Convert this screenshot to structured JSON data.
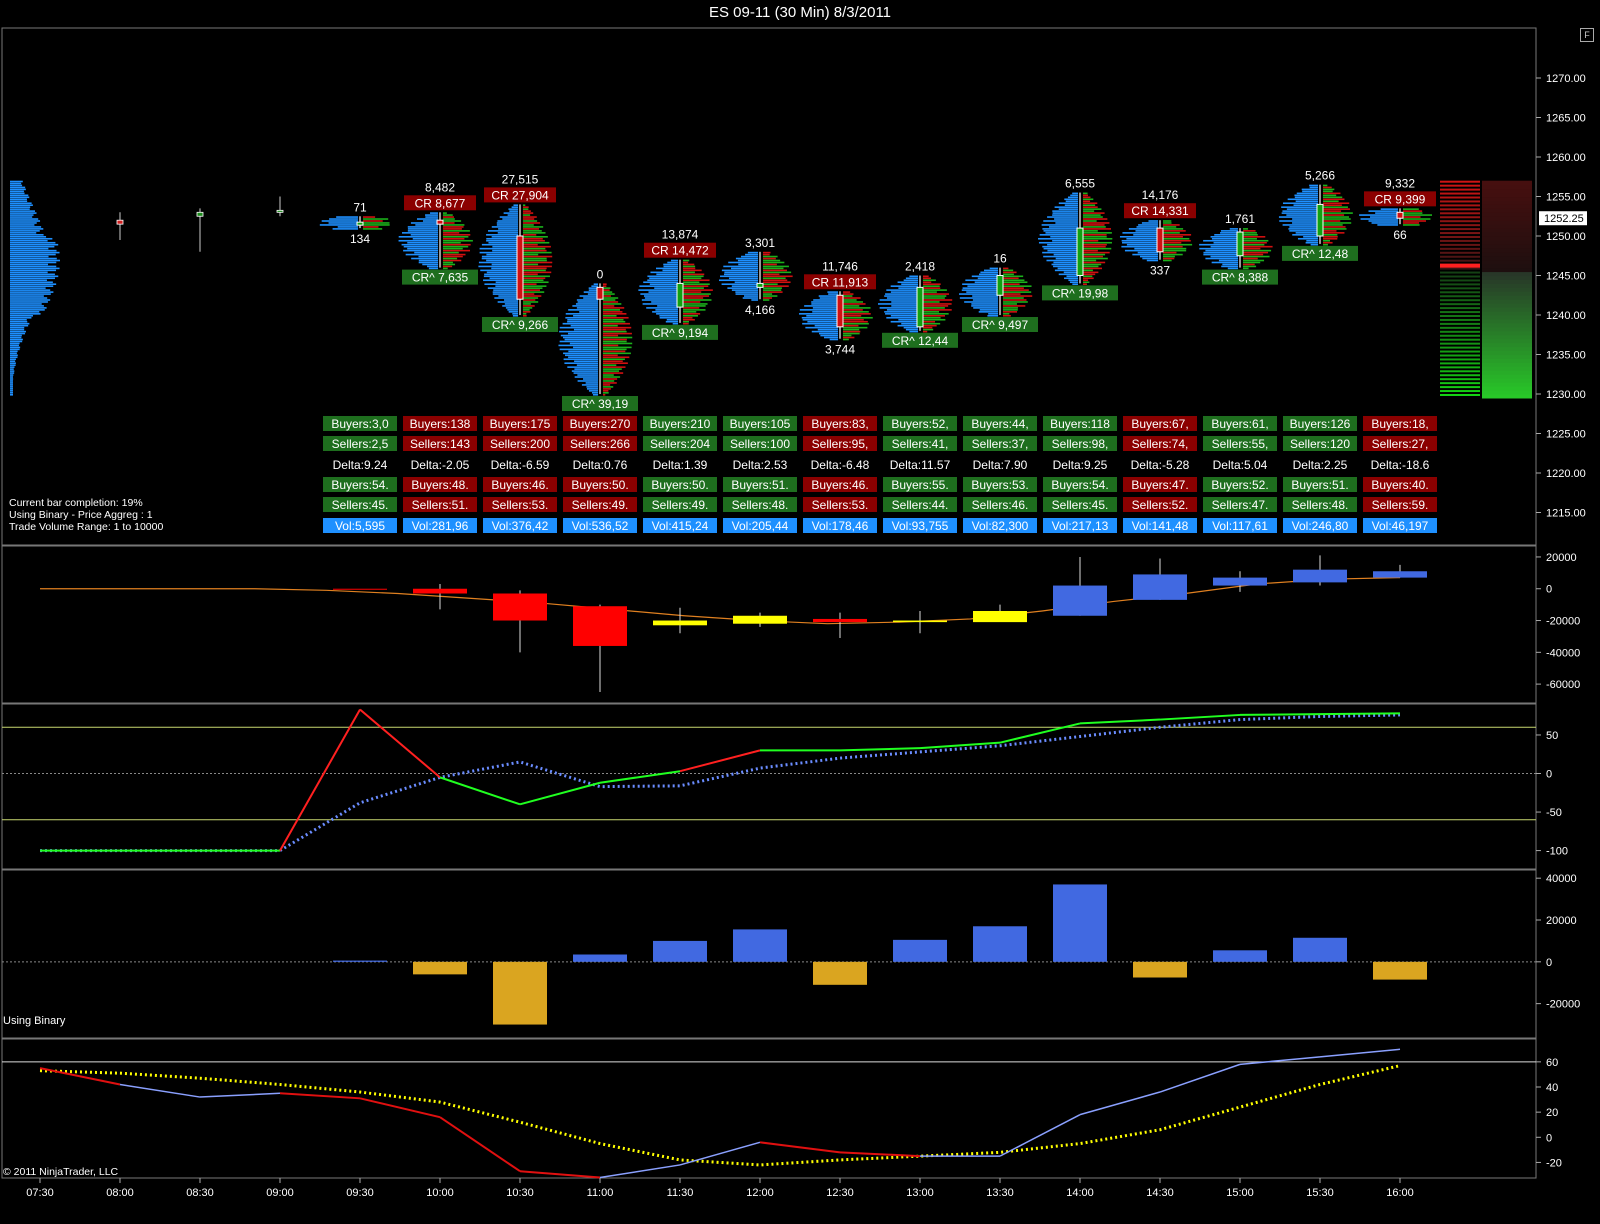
{
  "window": {
    "title": "ES 09-11 (30 Min)  8/3/2011",
    "flag_label": "F"
  },
  "time_labels": [
    "07:30",
    "08:00",
    "08:30",
    "09:00",
    "09:30",
    "10:00",
    "10:30",
    "11:00",
    "11:30",
    "12:00",
    "12:30",
    "13:00",
    "13:30",
    "14:00",
    "14:30",
    "15:00",
    "15:30",
    "16:00"
  ],
  "price_panel": {
    "info_lines": [
      "Current bar completion: 19%",
      "Using Binary - Price Aggreg : 1",
      "Trade Volume Range: 1 to 10000"
    ],
    "current_price": "1252.25",
    "y_ticks": [
      "1270.00",
      "1265.00",
      "1260.00",
      "1255.00",
      "1250.00",
      "1245.00",
      "1240.00",
      "1235.00",
      "1230.00",
      "1225.00",
      "1220.00",
      "1215.00"
    ]
  },
  "bars": [
    {
      "time": "09:30",
      "o": 1251.75,
      "h": 1252.5,
      "l": 1251,
      "c": 1251.5,
      "top": "71",
      "top_box": "",
      "bottom": "134",
      "bottom_box": "",
      "dir": "up",
      "buyers": "Buyers:3,0",
      "sellers": "Sellers:2,5",
      "delta": "Delta:9.24",
      "buyers_pct": "Buyers:54.",
      "sellers_pct": "Sellers:45.",
      "vol": "Vol:5,595"
    },
    {
      "time": "10:00",
      "o": 1252,
      "h": 1253,
      "l": 1246,
      "c": 1251.5,
      "top": "8,482",
      "top_box": "CR 8,677",
      "bottom": "",
      "bottom_box": "CR^ 7,635",
      "dir": "down",
      "buyers": "Buyers:138",
      "sellers": "Sellers:143",
      "delta": "Delta:-2.05",
      "buyers_pct": "Buyers:48.",
      "sellers_pct": "Sellers:51.",
      "vol": "Vol:281,96"
    },
    {
      "time": "10:30",
      "o": 1250,
      "h": 1254,
      "l": 1240,
      "c": 1242,
      "top": "27,515",
      "top_box": "CR 27,904",
      "bottom": "",
      "bottom_box": "CR^ 9,266",
      "dir": "down",
      "buyers": "Buyers:175",
      "sellers": "Sellers:200",
      "delta": "Delta:-6.59",
      "buyers_pct": "Buyers:46.",
      "sellers_pct": "Sellers:53.",
      "vol": "Vol:376,42"
    },
    {
      "time": "11:00",
      "o": 1243.5,
      "h": 1244,
      "l": 1230,
      "c": 1242,
      "top": "0",
      "top_box": "",
      "bottom": "",
      "bottom_box": "CR^ 39,19",
      "dir": "down",
      "buyers": "Buyers:270",
      "sellers": "Sellers:266",
      "delta": "Delta:0.76",
      "buyers_pct": "Buyers:50.",
      "sellers_pct": "Sellers:49.",
      "vol": "Vol:536,52"
    },
    {
      "time": "11:30",
      "o": 1241,
      "h": 1247,
      "l": 1239,
      "c": 1244,
      "top": "13,874",
      "top_box": "CR 14,472",
      "bottom": "",
      "bottom_box": "CR^ 9,194",
      "dir": "up",
      "buyers": "Buyers:210",
      "sellers": "Sellers:204",
      "delta": "Delta:1.39",
      "buyers_pct": "Buyers:50.",
      "sellers_pct": "Sellers:49.",
      "vol": "Vol:415,24"
    },
    {
      "time": "12:00",
      "o": 1243.5,
      "h": 1248,
      "l": 1242,
      "c": 1244,
      "top": "3,301",
      "top_box": "",
      "bottom": "4,166",
      "bottom_box": "",
      "dir": "up",
      "buyers": "Buyers:105",
      "sellers": "Sellers:100",
      "delta": "Delta:2.53",
      "buyers_pct": "Buyers:51.",
      "sellers_pct": "Sellers:48.",
      "vol": "Vol:205,44"
    },
    {
      "time": "12:30",
      "o": 1242.5,
      "h": 1243,
      "l": 1237,
      "c": 1238.5,
      "top": "11,746",
      "top_box": "CR 11,913",
      "bottom": "3,744",
      "bottom_box": "",
      "dir": "down",
      "buyers": "Buyers:83,",
      "sellers": "Sellers:95,",
      "delta": "Delta:-6.48",
      "buyers_pct": "Buyers:46.",
      "sellers_pct": "Sellers:53.",
      "vol": "Vol:178,46"
    },
    {
      "time": "13:00",
      "o": 1238.5,
      "h": 1245,
      "l": 1238,
      "c": 1243.5,
      "top": "2,418",
      "top_box": "",
      "bottom": "",
      "bottom_box": "CR^ 12,44",
      "dir": "up",
      "buyers": "Buyers:52,",
      "sellers": "Sellers:41,",
      "delta": "Delta:11.57",
      "buyers_pct": "Buyers:55.",
      "sellers_pct": "Sellers:44.",
      "vol": "Vol:93,755"
    },
    {
      "time": "13:30",
      "o": 1242.5,
      "h": 1246,
      "l": 1240,
      "c": 1245,
      "top": "16",
      "top_box": "",
      "bottom": "",
      "bottom_box": "CR^ 9,497",
      "dir": "up",
      "buyers": "Buyers:44,",
      "sellers": "Sellers:37,",
      "delta": "Delta:7.90",
      "buyers_pct": "Buyers:53.",
      "sellers_pct": "Sellers:46.",
      "vol": "Vol:82,300"
    },
    {
      "time": "14:00",
      "o": 1245,
      "h": 1255.5,
      "l": 1244,
      "c": 1251,
      "top": "6,555",
      "top_box": "",
      "bottom": "",
      "bottom_box": "CR^ 19,98",
      "dir": "up",
      "buyers": "Buyers:118",
      "sellers": "Sellers:98,",
      "delta": "Delta:9.25",
      "buyers_pct": "Buyers:54.",
      "sellers_pct": "Sellers:45.",
      "vol": "Vol:217,13"
    },
    {
      "time": "14:30",
      "o": 1251,
      "h": 1252,
      "l": 1247,
      "c": 1248,
      "top": "14,176",
      "top_box": "CR 14,331",
      "bottom": "337",
      "bottom_box": "",
      "dir": "down",
      "buyers": "Buyers:67,",
      "sellers": "Sellers:74,",
      "delta": "Delta:-5.28",
      "buyers_pct": "Buyers:47.",
      "sellers_pct": "Sellers:52.",
      "vol": "Vol:141,48"
    },
    {
      "time": "15:00",
      "o": 1247.5,
      "h": 1251,
      "l": 1246,
      "c": 1250.5,
      "top": "1,761",
      "top_box": "",
      "bottom": "",
      "bottom_box": "CR^ 8,388",
      "dir": "up",
      "buyers": "Buyers:61,",
      "sellers": "Sellers:55,",
      "delta": "Delta:5.04",
      "buyers_pct": "Buyers:52.",
      "sellers_pct": "Sellers:47.",
      "vol": "Vol:117,61"
    },
    {
      "time": "15:30",
      "o": 1250,
      "h": 1256.5,
      "l": 1249,
      "c": 1254,
      "top": "5,266",
      "top_box": "",
      "bottom": "",
      "bottom_box": "CR^ 12,48",
      "dir": "up",
      "buyers": "Buyers:126",
      "sellers": "Sellers:120",
      "delta": "Delta:2.25",
      "buyers_pct": "Buyers:51.",
      "sellers_pct": "Sellers:48.",
      "vol": "Vol:246,80"
    },
    {
      "time": "16:00",
      "o": 1253,
      "h": 1253.5,
      "l": 1251.5,
      "c": 1252.25,
      "top": "9,332",
      "top_box": "CR 9,399",
      "bottom": "66",
      "bottom_box": "",
      "dir": "down",
      "buyers": "Buyers:18,",
      "sellers": "Sellers:27,",
      "delta": "Delta:-18.6",
      "buyers_pct": "Buyers:40.",
      "sellers_pct": "Sellers:59.",
      "vol": "Vol:46,197"
    }
  ],
  "early_bars": [
    {
      "time": "08:00",
      "o": 1252,
      "h": 1253,
      "l": 1249.5,
      "c": 1251.5
    },
    {
      "time": "08:30",
      "o": 1252.5,
      "h": 1253.5,
      "l": 1248,
      "c": 1253
    },
    {
      "time": "09:00",
      "o": 1253,
      "h": 1255,
      "l": 1252.5,
      "c": 1253.25
    }
  ],
  "chart_data": [
    {
      "type": "candlestick",
      "panel": "delta candles",
      "y_ticks": [
        "20000",
        "0",
        "-20000",
        "-40000",
        "-60000"
      ],
      "ylim": [
        -70000,
        25000
      ],
      "x": [
        "09:30",
        "10:00",
        "10:30",
        "11:00",
        "11:30",
        "12:00",
        "12:30",
        "13:00",
        "13:30",
        "14:00",
        "14:30",
        "15:00",
        "15:30",
        "16:00"
      ],
      "open": [
        0,
        0,
        -3000,
        -11000,
        -20000,
        -17000,
        -19000,
        -21000,
        -14000,
        2000,
        -7000,
        2000,
        4000,
        7000
      ],
      "close": [
        0,
        -3000,
        -20000,
        -36000,
        -23000,
        -22000,
        -21000,
        -20000,
        -21000,
        -17000,
        9000,
        7000,
        12000,
        11000
      ],
      "high": [
        0,
        3000,
        -1000,
        -10000,
        -12000,
        -15000,
        -15000,
        -14000,
        -10000,
        20000,
        19000,
        11000,
        21000,
        15000
      ],
      "low": [
        0,
        -13000,
        -40000,
        -65000,
        -28000,
        -24000,
        -31000,
        -28000,
        -20000,
        -17000,
        -7000,
        -2000,
        2000,
        7000
      ],
      "colors": [
        "#ff0000",
        "#ff0000",
        "#ff0000",
        "#ff0000",
        "#ffff00",
        "#ffff00",
        "#ff0000",
        "#ffff00",
        "#ffff00",
        "#4169e1",
        "#4169e1",
        "#4169e1",
        "#4169e1",
        "#4169e1"
      ],
      "ma": [
        0,
        0,
        0,
        0,
        -1000,
        -3000,
        -6000,
        -9000,
        -13000,
        -17000,
        -20000,
        -22000,
        -21000,
        -19000,
        -14000,
        -8000,
        -3000,
        3000,
        6000,
        7000
      ]
    },
    {
      "type": "line",
      "panel": "oscillator",
      "y_ticks": [
        "50",
        "0",
        "-50",
        "-100"
      ],
      "ylim": [
        -120,
        85
      ],
      "levels": [
        60,
        0,
        -60
      ],
      "x": [
        "07:30",
        "08:00",
        "08:30",
        "09:00",
        "09:30",
        "10:00",
        "10:30",
        "11:00",
        "11:30",
        "12:00",
        "12:30",
        "13:00",
        "13:30",
        "14:00",
        "14:30",
        "15:00",
        "15:30",
        "16:00"
      ],
      "main": [
        -100,
        -100,
        -100,
        -100,
        83,
        -5,
        -40,
        -12,
        3,
        30,
        30,
        33,
        40,
        65,
        70,
        76,
        77,
        78
      ],
      "main_down": [
        false,
        false,
        false,
        false,
        true,
        true,
        false,
        false,
        false,
        true,
        false,
        false,
        false,
        false,
        false,
        false,
        false,
        false
      ],
      "signal": [
        -100,
        -100,
        -100,
        -100,
        -38,
        -5,
        15,
        -17,
        -16,
        7,
        20,
        28,
        36,
        48,
        60,
        70,
        74,
        76
      ]
    },
    {
      "type": "bar",
      "panel": "histogram",
      "label": "Using Binary",
      "y_ticks": [
        "40000",
        "20000",
        "0",
        "-20000"
      ],
      "ylim": [
        -35000,
        42000
      ],
      "x": [
        "09:30",
        "10:00",
        "10:30",
        "11:00",
        "11:30",
        "12:00",
        "12:30",
        "13:00",
        "13:30",
        "14:00",
        "14:30",
        "15:00",
        "15:30",
        "16:00"
      ],
      "values": [
        600,
        -6000,
        -30000,
        3500,
        10000,
        15500,
        -11000,
        10500,
        17000,
        37000,
        -7500,
        5500,
        11500,
        -8500
      ],
      "positive_color": "#4169e1",
      "negative_color": "#daa520"
    },
    {
      "type": "line",
      "panel": "stochastic",
      "y_ticks": [
        "60",
        "40",
        "20",
        "0",
        "-20"
      ],
      "ylim": [
        -30,
        75
      ],
      "level": 60,
      "x": [
        "07:30",
        "08:00",
        "08:30",
        "09:00",
        "09:30",
        "10:00",
        "10:30",
        "11:00",
        "11:30",
        "12:00",
        "12:30",
        "13:00",
        "13:30",
        "14:00",
        "14:30",
        "15:00",
        "15:30",
        "16:00"
      ],
      "k": [
        55,
        42,
        32,
        35,
        31,
        16,
        -27,
        -32,
        -22,
        -4,
        -12,
        -15,
        -15,
        18,
        36,
        58,
        64,
        70
      ],
      "k_down": [
        true,
        true,
        false,
        false,
        true,
        true,
        true,
        true,
        false,
        false,
        true,
        true,
        false,
        false,
        false,
        false,
        false,
        false
      ],
      "d": [
        53,
        51,
        47,
        42,
        36,
        28,
        12,
        -5,
        -18,
        -22,
        -18,
        -15,
        -12,
        -5,
        6,
        24,
        42,
        57
      ]
    }
  ],
  "copyright": "© 2011 NinjaTrader, LLC",
  "colors": {
    "up_box": "#1e6e1e",
    "down_box": "#8b0000",
    "vol_box": "#1e90ff",
    "profile": "#1e90ff"
  }
}
